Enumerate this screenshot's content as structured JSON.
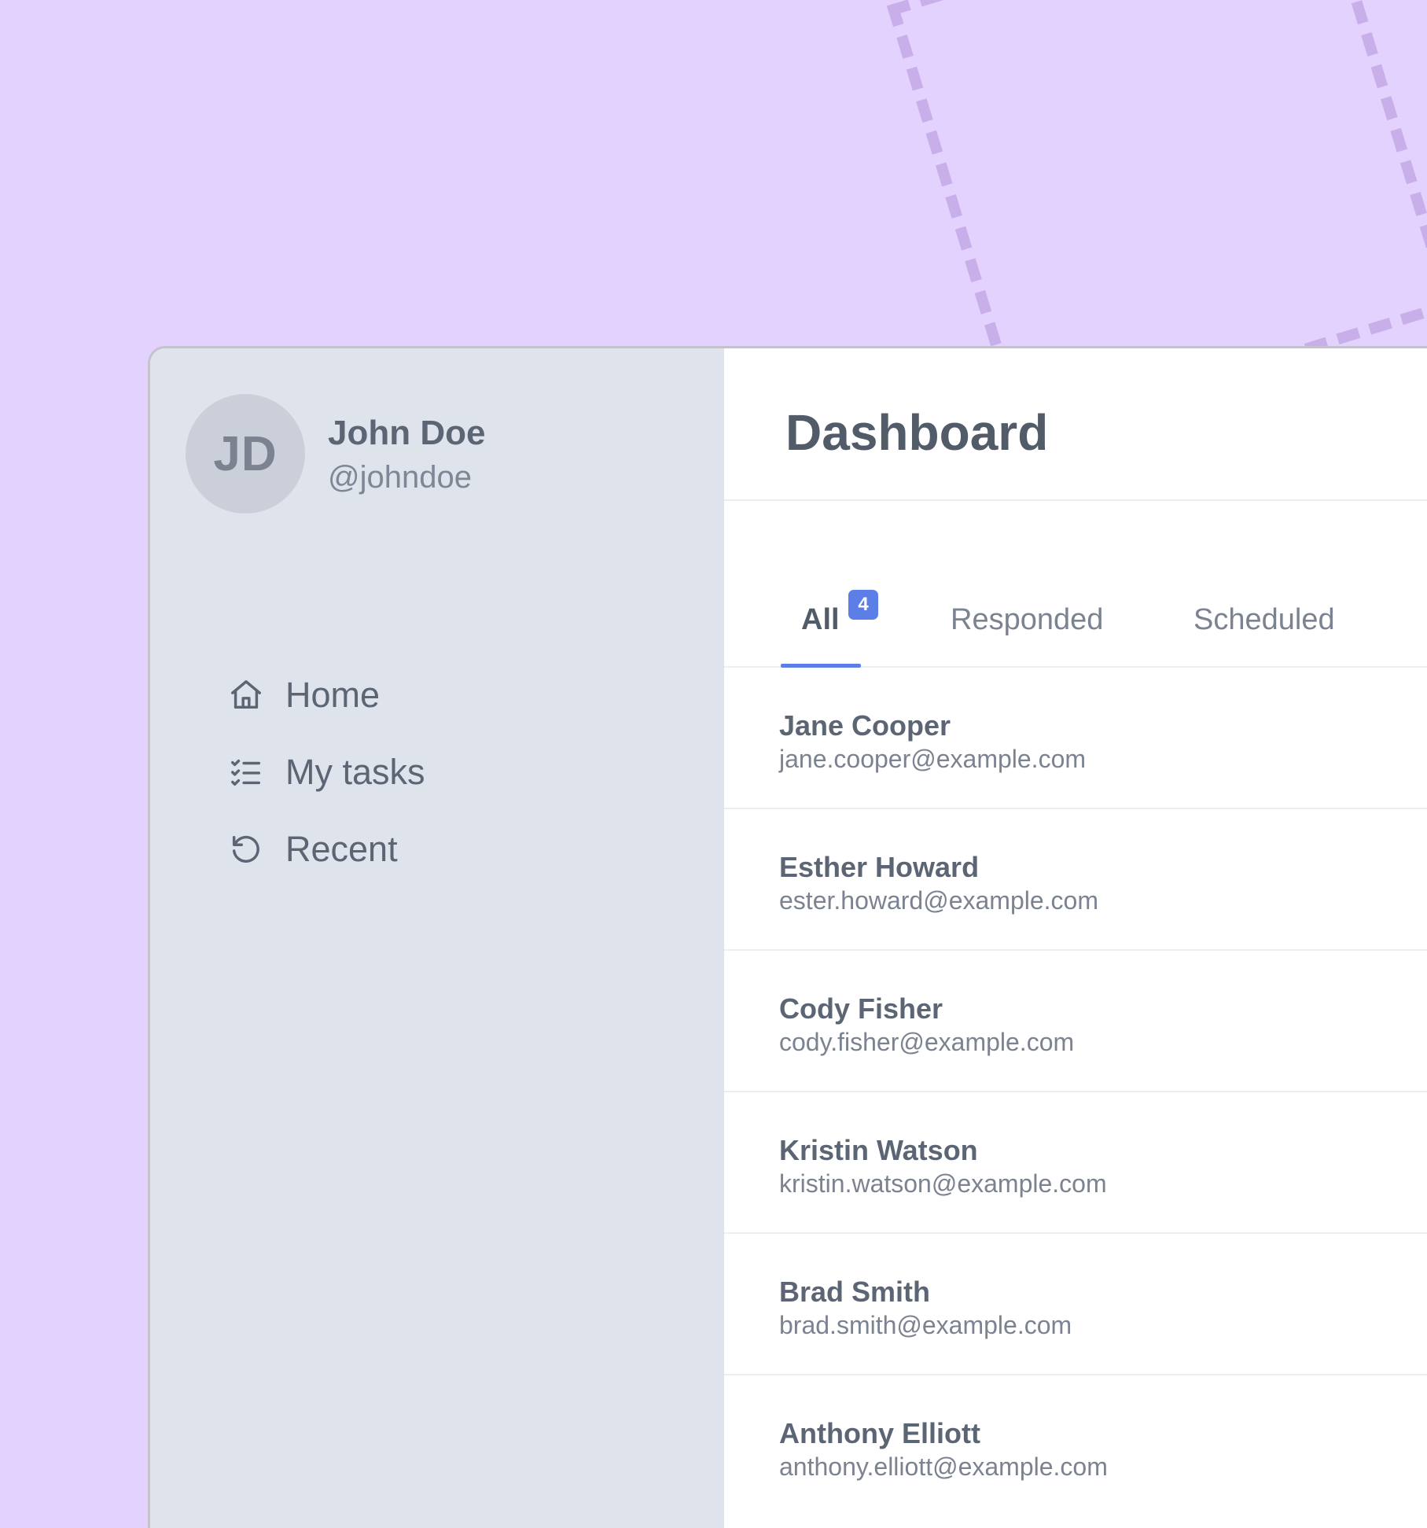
{
  "user": {
    "initials": "JD",
    "name": "John Doe",
    "handle": "@johndoe"
  },
  "nav": {
    "items": [
      {
        "label": "Home",
        "icon": "home-icon"
      },
      {
        "label": "My tasks",
        "icon": "task-list-icon"
      },
      {
        "label": "Recent",
        "icon": "history-icon"
      }
    ]
  },
  "main": {
    "title": "Dashboard",
    "tabs": [
      {
        "label": "All",
        "badge": "4",
        "active": true
      },
      {
        "label": "Responded",
        "active": false
      },
      {
        "label": "Scheduled",
        "active": false
      }
    ],
    "contacts": [
      {
        "name": "Jane Cooper",
        "email": "jane.cooper@example.com"
      },
      {
        "name": "Esther Howard",
        "email": "ester.howard@example.com"
      },
      {
        "name": "Cody Fisher",
        "email": "cody.fisher@example.com"
      },
      {
        "name": "Kristin Watson",
        "email": "kristin.watson@example.com"
      },
      {
        "name": "Brad Smith",
        "email": "brad.smith@example.com"
      },
      {
        "name": "Anthony Elliott",
        "email": "anthony.elliott@example.com"
      }
    ]
  },
  "colors": {
    "background": "#e2d2fd",
    "sidebar": "#dfe3ec",
    "accent": "#5b7fe6",
    "text": "#5c6573"
  }
}
